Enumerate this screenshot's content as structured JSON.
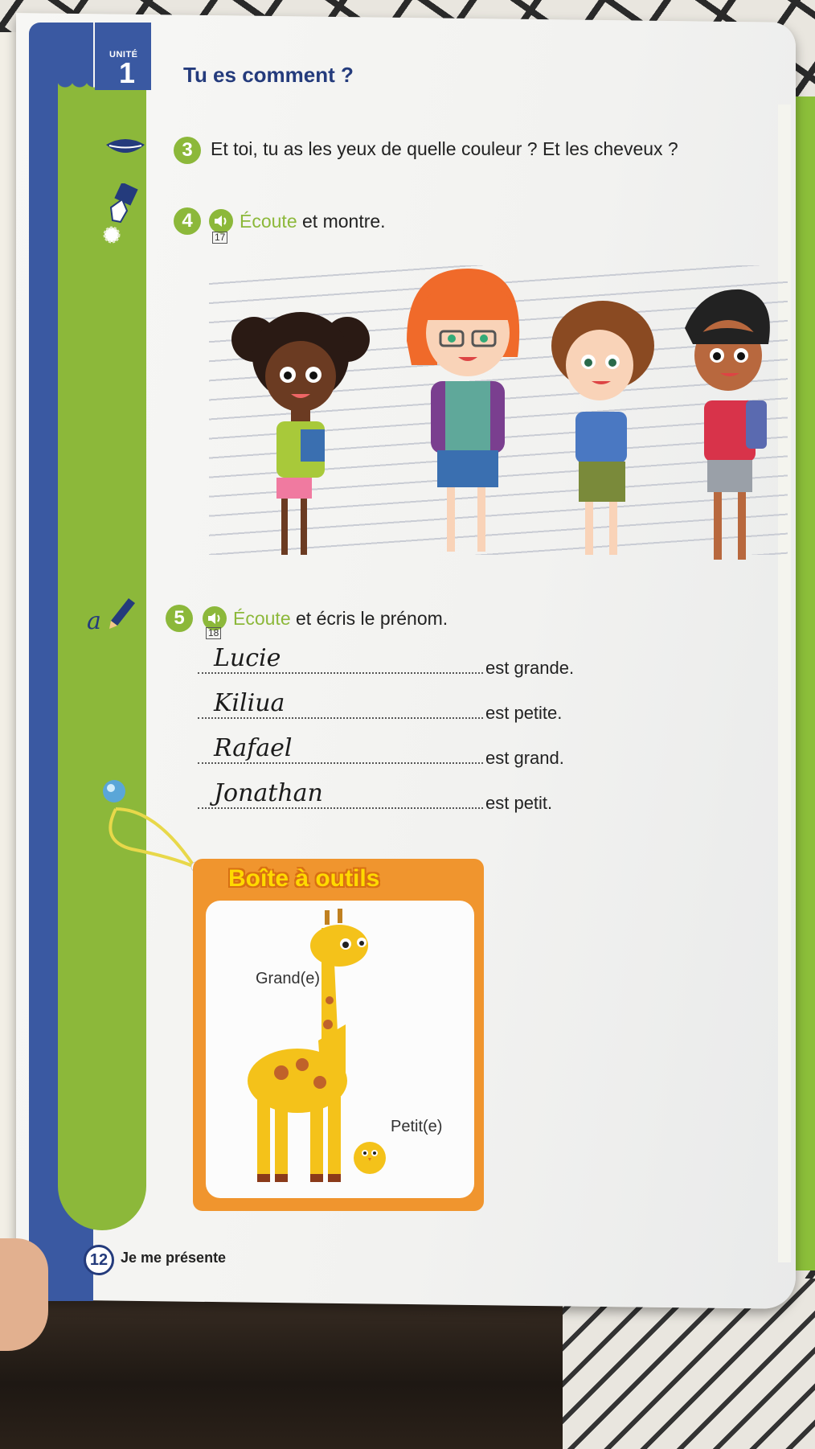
{
  "unit": {
    "label": "UNITÉ",
    "number": "1"
  },
  "title": "Tu es comment ?",
  "exercise3": {
    "number": "3",
    "text": "Et toi, tu as les yeux de quelle couleur ? Et les cheveux ?"
  },
  "exercise4": {
    "number": "4",
    "track": "17",
    "verb": "Écoute",
    "rest": " et montre."
  },
  "exercise5": {
    "number": "5",
    "track": "18",
    "verb": "Écoute",
    "rest": " et écris le prénom.",
    "rows": [
      {
        "handwritten": "Lucie",
        "text": "est grande."
      },
      {
        "handwritten": "Kiliua",
        "text": "est petite."
      },
      {
        "handwritten": "Rafael",
        "text": "est grand."
      },
      {
        "handwritten": "Jonathan",
        "text": "est petit."
      }
    ]
  },
  "toolbox": {
    "title": "Boîte à outils",
    "label_tall": "Grand(e)",
    "label_small": "Petit(e)"
  },
  "footer": {
    "page": "12",
    "section": "Je me présente"
  },
  "colors": {
    "blue": "#3a59a2",
    "green": "#8cb83a",
    "orange": "#f0952e",
    "navy": "#243b7c"
  },
  "icons": [
    "mouth-icon",
    "pointing-hand-icon",
    "pencil-write-icon",
    "audio-speaker-icon",
    "pin-icon"
  ]
}
